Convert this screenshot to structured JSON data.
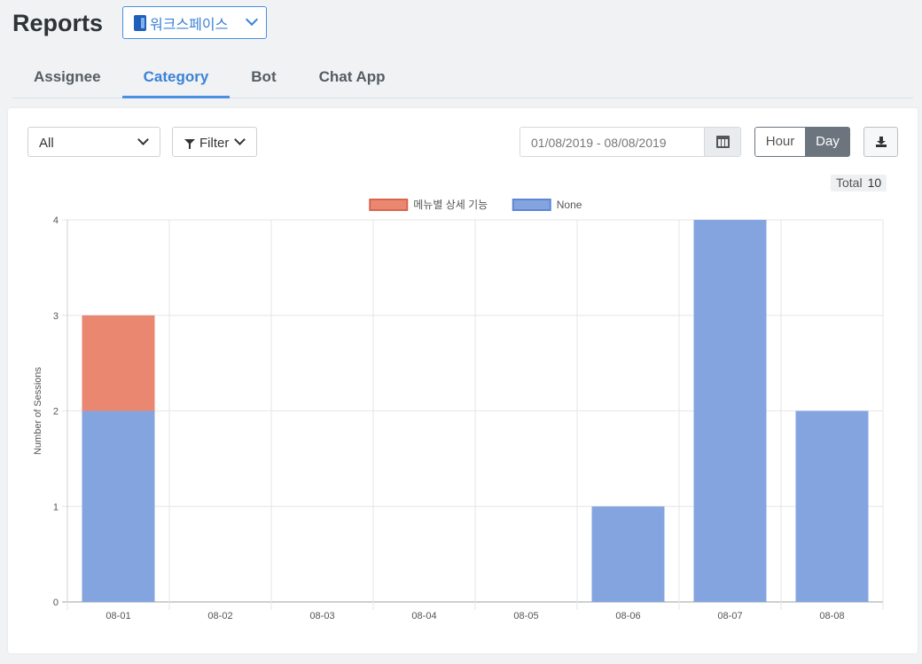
{
  "header": {
    "title": "Reports",
    "workspace": "워크스페이스"
  },
  "tabs": [
    {
      "label": "Assignee",
      "active": false
    },
    {
      "label": "Category",
      "active": true
    },
    {
      "label": "Bot",
      "active": false
    },
    {
      "label": "Chat App",
      "active": false
    }
  ],
  "toolbar": {
    "category_select": "All",
    "filter_label": "Filter",
    "date_range": "01/08/2019 - 08/08/2019",
    "hour_label": "Hour",
    "day_label": "Day",
    "selected_granularity": "Day"
  },
  "total": {
    "label": "Total",
    "value": "10"
  },
  "colors": {
    "accent": "#4a90e2",
    "series_menu": "#ea8770",
    "series_none": "#84a4e0"
  },
  "chart_data": {
    "type": "bar",
    "stacked": true,
    "categories": [
      "08-01",
      "08-02",
      "08-03",
      "08-04",
      "08-05",
      "08-06",
      "08-07",
      "08-08"
    ],
    "series": [
      {
        "name": "None",
        "color": "#84a4e0",
        "values": [
          2,
          0,
          0,
          0,
          0,
          1,
          4,
          2
        ]
      },
      {
        "name": "메뉴별 상세 기능",
        "color": "#ea8770",
        "values": [
          1,
          0,
          0,
          0,
          0,
          0,
          0,
          0
        ]
      }
    ],
    "legend_order": [
      "메뉴별 상세 기능",
      "None"
    ],
    "ylabel": "Number of Sessions",
    "xlabel": "",
    "ylim": [
      0,
      4
    ],
    "yticks": [
      0,
      1,
      2,
      3,
      4
    ],
    "grid": true,
    "legend_position": "top"
  }
}
